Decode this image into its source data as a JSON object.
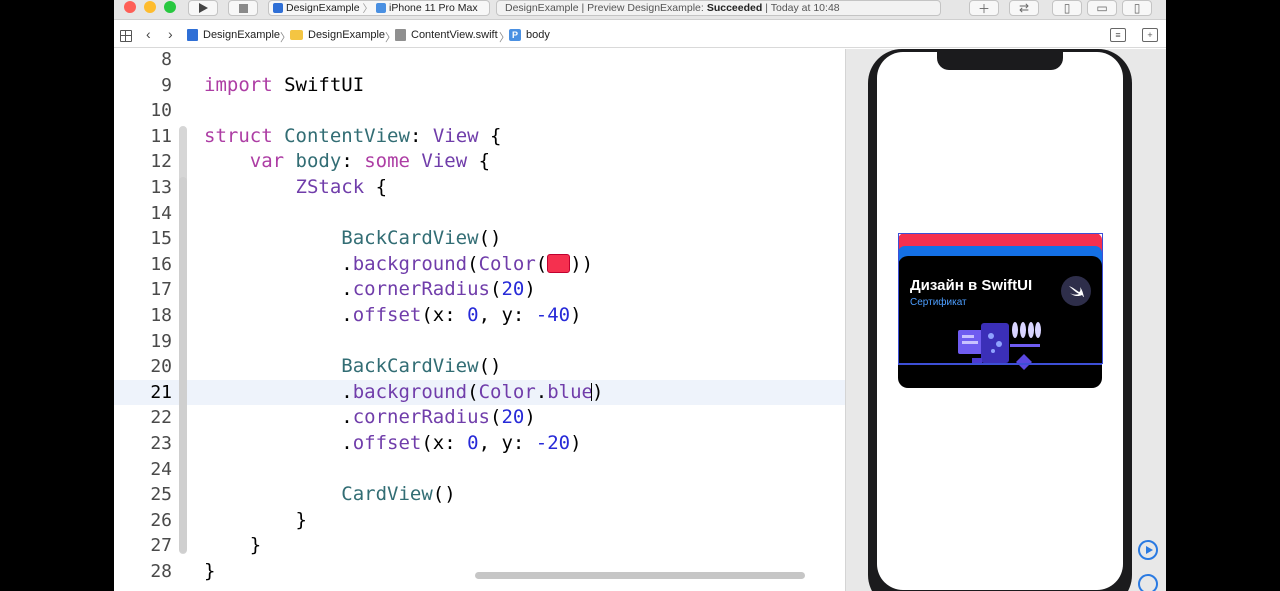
{
  "toolbar": {
    "scheme_target": "DesignExample",
    "scheme_device": "iPhone 11 Pro Max",
    "status_prefix": "DesignExample | Preview DesignExample:",
    "status_result": "Succeeded",
    "status_time": "| Today at 10:48"
  },
  "jumpbar": {
    "crumbs": [
      "DesignExample",
      "DesignExample",
      "ContentView.swift",
      "body"
    ]
  },
  "editor": {
    "current_line": 21,
    "lines": [
      {
        "num": "8"
      },
      {
        "num": "9",
        "tokens": [
          {
            "t": "import",
            "c": "kw"
          },
          {
            "t": " SwiftUI",
            "c": ""
          }
        ]
      },
      {
        "num": "10"
      },
      {
        "num": "11",
        "tokens": [
          {
            "t": "struct",
            "c": "kw"
          },
          {
            "t": " ",
            "c": ""
          },
          {
            "t": "ContentView",
            "c": "fn"
          },
          {
            "t": ": ",
            "c": ""
          },
          {
            "t": "View",
            "c": "tp"
          },
          {
            "t": " {",
            "c": ""
          }
        ]
      },
      {
        "num": "12",
        "tokens": [
          {
            "t": "    ",
            "c": ""
          },
          {
            "t": "var",
            "c": "kw"
          },
          {
            "t": " ",
            "c": ""
          },
          {
            "t": "body",
            "c": "fn"
          },
          {
            "t": ": ",
            "c": ""
          },
          {
            "t": "some",
            "c": "kw"
          },
          {
            "t": " ",
            "c": ""
          },
          {
            "t": "View",
            "c": "tp"
          },
          {
            "t": " {",
            "c": ""
          }
        ]
      },
      {
        "num": "13",
        "tokens": [
          {
            "t": "        ",
            "c": ""
          },
          {
            "t": "ZStack",
            "c": "tp"
          },
          {
            "t": " {",
            "c": ""
          }
        ]
      },
      {
        "num": "14"
      },
      {
        "num": "15",
        "tokens": [
          {
            "t": "            ",
            "c": ""
          },
          {
            "t": "BackCardView",
            "c": "fn"
          },
          {
            "t": "()",
            "c": ""
          }
        ]
      },
      {
        "num": "16",
        "tokens": [
          {
            "t": "            .",
            "c": ""
          },
          {
            "t": "background",
            "c": "tp"
          },
          {
            "t": "(",
            "c": ""
          },
          {
            "t": "Color",
            "c": "tp"
          },
          {
            "t": "(",
            "c": ""
          },
          {
            "swatch": "#f5304f"
          },
          {
            "t": "))",
            "c": ""
          }
        ]
      },
      {
        "num": "17",
        "tokens": [
          {
            "t": "            .",
            "c": ""
          },
          {
            "t": "cornerRadius",
            "c": "tp"
          },
          {
            "t": "(",
            "c": ""
          },
          {
            "t": "20",
            "c": "num"
          },
          {
            "t": ")",
            "c": ""
          }
        ]
      },
      {
        "num": "18",
        "tokens": [
          {
            "t": "            .",
            "c": ""
          },
          {
            "t": "offset",
            "c": "tp"
          },
          {
            "t": "(x: ",
            "c": ""
          },
          {
            "t": "0",
            "c": "num"
          },
          {
            "t": ", y: ",
            "c": ""
          },
          {
            "t": "-40",
            "c": "num"
          },
          {
            "t": ")",
            "c": ""
          }
        ]
      },
      {
        "num": "19"
      },
      {
        "num": "20",
        "tokens": [
          {
            "t": "            ",
            "c": ""
          },
          {
            "t": "BackCardView",
            "c": "fn"
          },
          {
            "t": "()",
            "c": ""
          }
        ]
      },
      {
        "num": "21",
        "tokens": [
          {
            "t": "            .",
            "c": ""
          },
          {
            "t": "background",
            "c": "tp"
          },
          {
            "t": "(",
            "c": ""
          },
          {
            "t": "Color",
            "c": "tp"
          },
          {
            "t": ".",
            "c": ""
          },
          {
            "t": "blue",
            "c": "tp"
          },
          {
            "cursor": true
          },
          {
            "t": ")",
            "c": ""
          }
        ]
      },
      {
        "num": "22",
        "tokens": [
          {
            "t": "            .",
            "c": ""
          },
          {
            "t": "cornerRadius",
            "c": "tp"
          },
          {
            "t": "(",
            "c": ""
          },
          {
            "t": "20",
            "c": "num"
          },
          {
            "t": ")",
            "c": ""
          }
        ]
      },
      {
        "num": "23",
        "tokens": [
          {
            "t": "            .",
            "c": ""
          },
          {
            "t": "offset",
            "c": "tp"
          },
          {
            "t": "(x: ",
            "c": ""
          },
          {
            "t": "0",
            "c": "num"
          },
          {
            "t": ", y: ",
            "c": ""
          },
          {
            "t": "-20",
            "c": "num"
          },
          {
            "t": ")",
            "c": ""
          }
        ]
      },
      {
        "num": "24"
      },
      {
        "num": "25",
        "tokens": [
          {
            "t": "            ",
            "c": ""
          },
          {
            "t": "CardView",
            "c": "fn"
          },
          {
            "t": "()",
            "c": ""
          }
        ]
      },
      {
        "num": "26",
        "tokens": [
          {
            "t": "        }",
            "c": ""
          }
        ]
      },
      {
        "num": "27",
        "tokens": [
          {
            "t": "    }",
            "c": ""
          }
        ]
      },
      {
        "num": "28",
        "tokens": [
          {
            "t": "}",
            "c": ""
          }
        ]
      }
    ]
  },
  "preview": {
    "card_title": "Дизайн в SwiftUI",
    "card_subtitle": "Сертификат"
  },
  "colors": {
    "keyword": "#ad3da4",
    "type": "#703daa",
    "declaration": "#326d74",
    "number": "#272ad8",
    "card_red": "#f5304f",
    "card_blue": "#1470e6",
    "accent": "#2a7ae2"
  },
  "icons": [
    "play-icon",
    "stop-icon",
    "grid-icon",
    "chevron-left-icon",
    "chevron-right-icon",
    "project-icon",
    "folder-icon",
    "swift-file-icon",
    "property-icon",
    "swift-logo-icon",
    "live-preview-icon",
    "inspect-preview-icon"
  ]
}
